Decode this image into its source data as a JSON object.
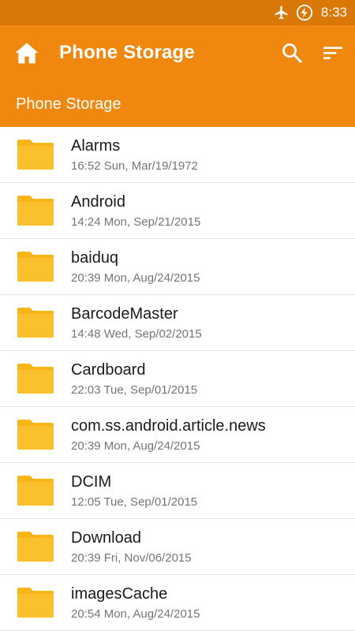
{
  "status_bar": {
    "time": "8:33",
    "icons": [
      "airplane-mode-icon",
      "battery-charging-icon"
    ]
  },
  "toolbar": {
    "title": "Phone Storage",
    "icons": [
      "home-icon",
      "search-icon",
      "sort-icon"
    ]
  },
  "breadcrumb": {
    "path": "Phone Storage"
  },
  "files": [
    {
      "name": "Alarms",
      "date": "16:52 Sun, Mar/19/1972",
      "icon": "folder-icon"
    },
    {
      "name": "Android",
      "date": "14:24 Mon, Sep/21/2015",
      "icon": "folder-icon"
    },
    {
      "name": "baiduq",
      "date": "20:39 Mon, Aug/24/2015",
      "icon": "folder-icon"
    },
    {
      "name": "BarcodeMaster",
      "date": "14:48 Wed, Sep/02/2015",
      "icon": "folder-icon"
    },
    {
      "name": "Cardboard",
      "date": "22:03 Tue, Sep/01/2015",
      "icon": "folder-icon"
    },
    {
      "name": "com.ss.android.article.news",
      "date": "20:39 Mon, Aug/24/2015",
      "icon": "folder-icon"
    },
    {
      "name": "DCIM",
      "date": "12:05 Tue, Sep/01/2015",
      "icon": "folder-icon"
    },
    {
      "name": "Download",
      "date": "20:39 Fri, Nov/06/2015",
      "icon": "folder-icon"
    },
    {
      "name": "imagesCache",
      "date": "20:54 Mon, Aug/24/2015",
      "icon": "folder-icon"
    }
  ],
  "colors": {
    "status_bar": "#d97806",
    "toolbar": "#f0870f",
    "folder": "#fbc02d",
    "folder_tab": "#f9a825"
  }
}
